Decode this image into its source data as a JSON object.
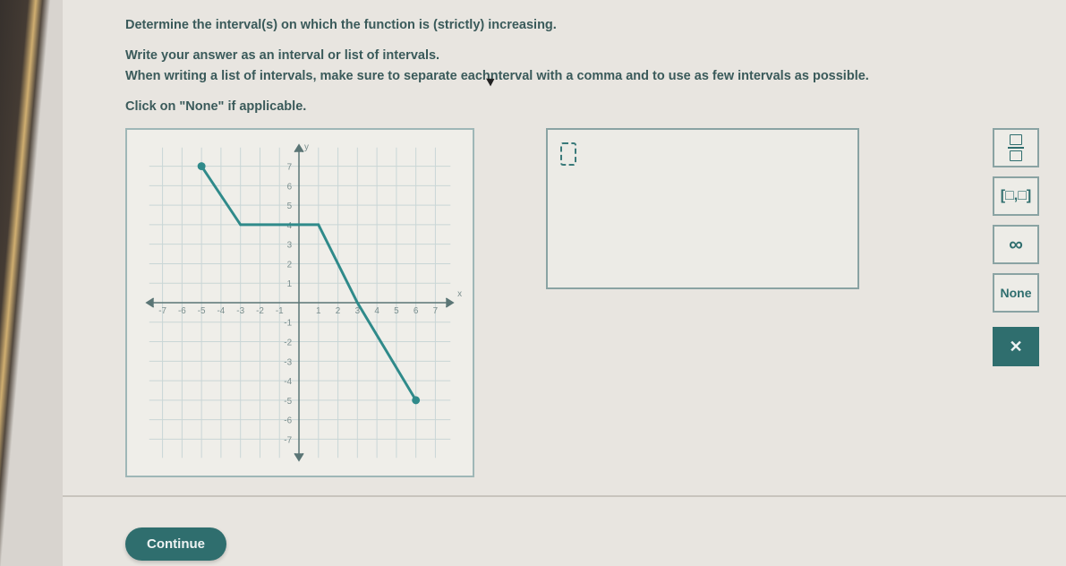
{
  "question": {
    "line1": "Determine the interval(s) on which the function is (strictly) increasing.",
    "line2": "Write your answer as an interval or list of intervals.",
    "line3_pre": "When writing a list of intervals, make sure to separate each",
    "line3_post": "nterval with a comma and to use as few intervals as possible.",
    "line4": "Click on \"None\" if applicable."
  },
  "chart_data": {
    "type": "line",
    "xlabel": "x",
    "ylabel": "y",
    "xlim": [
      -7,
      7
    ],
    "ylim": [
      -7,
      7
    ],
    "x_ticks": [
      -7,
      -6,
      -5,
      -4,
      -3,
      -2,
      -1,
      1,
      2,
      3,
      4,
      5,
      6,
      7
    ],
    "y_ticks": [
      -7,
      -6,
      -5,
      -4,
      -3,
      -2,
      -1,
      1,
      2,
      3,
      4,
      5,
      6,
      7
    ],
    "points": [
      {
        "x": -5,
        "y": 7,
        "endpoint": "closed"
      },
      {
        "x": -3,
        "y": 4
      },
      {
        "x": -1,
        "y": 4
      },
      {
        "x": 1,
        "y": 4
      },
      {
        "x": 3,
        "y": 0
      },
      {
        "x": 6,
        "y": -5,
        "endpoint": "closed"
      }
    ]
  },
  "answer": {
    "current_value": ""
  },
  "tools": {
    "fraction_label": "fraction",
    "interval_label": "[□,□]",
    "infinity_label": "∞",
    "none_label": "None",
    "close_label": "✕"
  },
  "buttons": {
    "continue": "Continue"
  }
}
